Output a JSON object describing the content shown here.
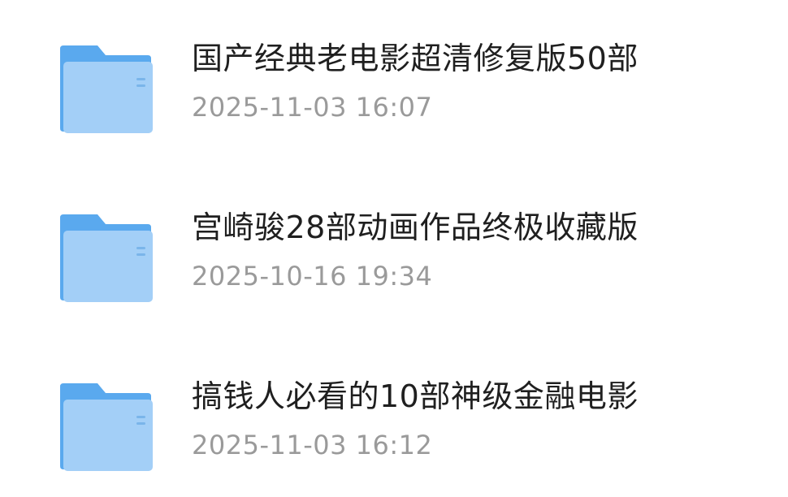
{
  "files": [
    {
      "name": "国产经典老电影超清修复版50部",
      "date": "2025-11-03 16:07",
      "icon": "folder-icon"
    },
    {
      "name": "宫崎骏28部动画作品终极收藏版",
      "date": "2025-10-16 19:34",
      "icon": "folder-icon"
    },
    {
      "name": "搞钱人必看的10部神级金融电影",
      "date": "2025-11-03 16:12",
      "icon": "folder-icon"
    }
  ],
  "colors": {
    "folder_back": "#5aa9ee",
    "folder_front": "#9fcdf6",
    "title_text": "#1f1f1f",
    "date_text": "#9a9a9a"
  }
}
